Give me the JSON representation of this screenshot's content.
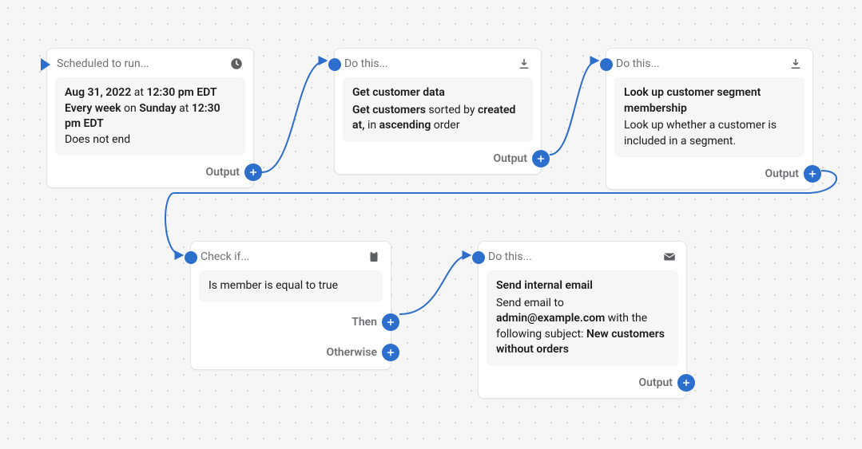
{
  "labels": {
    "output": "Output",
    "then": "Then",
    "otherwise": "Otherwise"
  },
  "nodes": {
    "schedule": {
      "header": "Scheduled to run...",
      "body_html": "<b>Aug 31, 2022</b> at <b>12:30 pm EDT</b><br/><b>Every week</b> on <b>Sunday</b> at <b>12:30 pm EDT</b><br/>Does not end"
    },
    "getCustomer": {
      "header": "Do this...",
      "title": "Get customer data",
      "desc_html": "<b>Get customers</b> sorted by <b>created at,</b> in <b>ascending</b> order"
    },
    "lookup": {
      "header": "Do this...",
      "title": "Look up customer segment membership",
      "desc_plain": "Look up whether a customer is included in a segment."
    },
    "check": {
      "header": "Check if...",
      "condition": "Is member is equal to true"
    },
    "email": {
      "header": "Do this...",
      "title": "Send internal email",
      "desc_html": "Send email to <b>admin@example.com</b> with the following subject: <b>New customers without orders</b>"
    }
  }
}
